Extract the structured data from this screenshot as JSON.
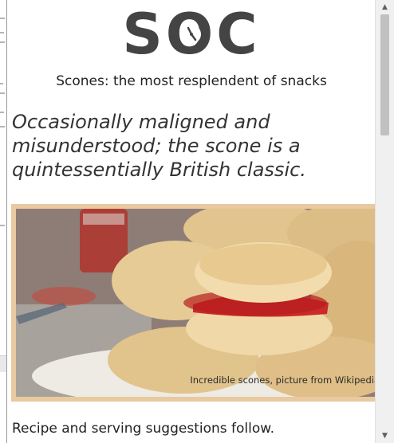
{
  "site": {
    "logo_text": {
      "s": "S",
      "o": "O",
      "c": "C"
    },
    "tagline": "Scones: the most resplendent of snacks"
  },
  "article": {
    "lede": "Occasionally maligned and misunderstood; the scone is a quintessentially British classic.",
    "image_caption": "Incredible scones, picture from Wikipedia",
    "recipe_intro": "Recipe and serving suggestions follow."
  },
  "colors": {
    "logo": "#444444",
    "frame": "#e8c9a0"
  },
  "icons": {
    "logo_o": "clock-icon",
    "scroll_up": "chevron-up-icon",
    "scroll_down": "chevron-down-icon"
  }
}
